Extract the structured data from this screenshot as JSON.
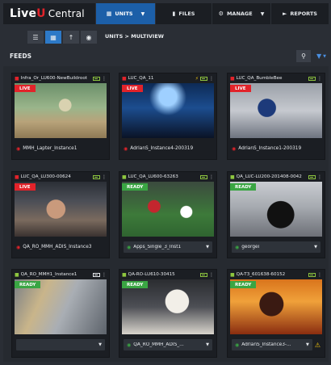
{
  "nav": {
    "logo_live": "Live",
    "logo_u": "U",
    "logo_central": "Central",
    "tabs": [
      {
        "label": "UNITS",
        "icon": "grid-icon",
        "active": true,
        "dropdown": true
      },
      {
        "label": "FILES",
        "icon": "file-icon",
        "active": false,
        "dropdown": false
      },
      {
        "label": "MANAGE",
        "icon": "gear-icon",
        "active": false,
        "dropdown": true
      },
      {
        "label": "REPORTS",
        "icon": "report-icon",
        "active": false,
        "dropdown": false
      }
    ]
  },
  "toolbar": {
    "views": [
      "list-view-icon",
      "multiview-icon",
      "upload-icon",
      "map-pin-icon"
    ],
    "breadcrumb": "UNITS > MULTIVIEW"
  },
  "feeds": {
    "title": "FEEDS"
  },
  "cards": [
    {
      "name": "Infra_Or_LU600-NewBuildroot",
      "status": "LIVE",
      "device": "live",
      "battery": true,
      "flash": false,
      "footer": "MMH_Lapter_Instance1",
      "footer_status": "red",
      "dropdown": false,
      "warning": false
    },
    {
      "name": "LUC_QA_11",
      "status": "LIVE",
      "device": "live",
      "battery": true,
      "flash": true,
      "footer": "AdrianS_Instance4-200319",
      "footer_status": "red",
      "dropdown": false,
      "warning": false
    },
    {
      "name": "LUC_QA_BumbleBee",
      "status": "LIVE",
      "device": "live",
      "battery": true,
      "flash": false,
      "footer": "AdrianS_Instance1-200319",
      "footer_status": "red",
      "dropdown": false,
      "warning": false
    },
    {
      "name": "LUC_QA_LU300-00624",
      "status": "LIVE",
      "device": "live",
      "battery": true,
      "flash": false,
      "footer": "QA_RO_MMH_ADIS_Instance3",
      "footer_status": "red",
      "dropdown": false,
      "warning": false
    },
    {
      "name": "LUC_QA_LU600-63263",
      "status": "READY",
      "device": "green",
      "battery": true,
      "flash": false,
      "footer": "Apps_Single_3_Inst1",
      "footer_status": "green",
      "dropdown": true,
      "warning": false
    },
    {
      "name": "QA_LUC-LU200-201408-0042",
      "status": "READY",
      "device": "green",
      "battery": true,
      "flash": false,
      "footer": "georgei",
      "footer_status": "green",
      "dropdown": true,
      "warning": false
    },
    {
      "name": "QA_RO_MMH1_Instance1",
      "status": "READY",
      "device": "green",
      "battery": false,
      "flash": false,
      "footer": "",
      "footer_status": "none",
      "dropdown": true,
      "warning": false
    },
    {
      "name": "QA-RO-LU610-30415",
      "status": "READY",
      "device": "green",
      "battery": true,
      "flash": false,
      "footer": "QA_RO_MMH_ADIS_...",
      "footer_status": "green",
      "dropdown": true,
      "warning": false
    },
    {
      "name": "QA-T3_601638-60152",
      "status": "READY",
      "device": "green",
      "battery": true,
      "flash": false,
      "footer": "AdrianS_Instance3-...",
      "footer_status": "green",
      "dropdown": true,
      "warning": true
    }
  ]
}
